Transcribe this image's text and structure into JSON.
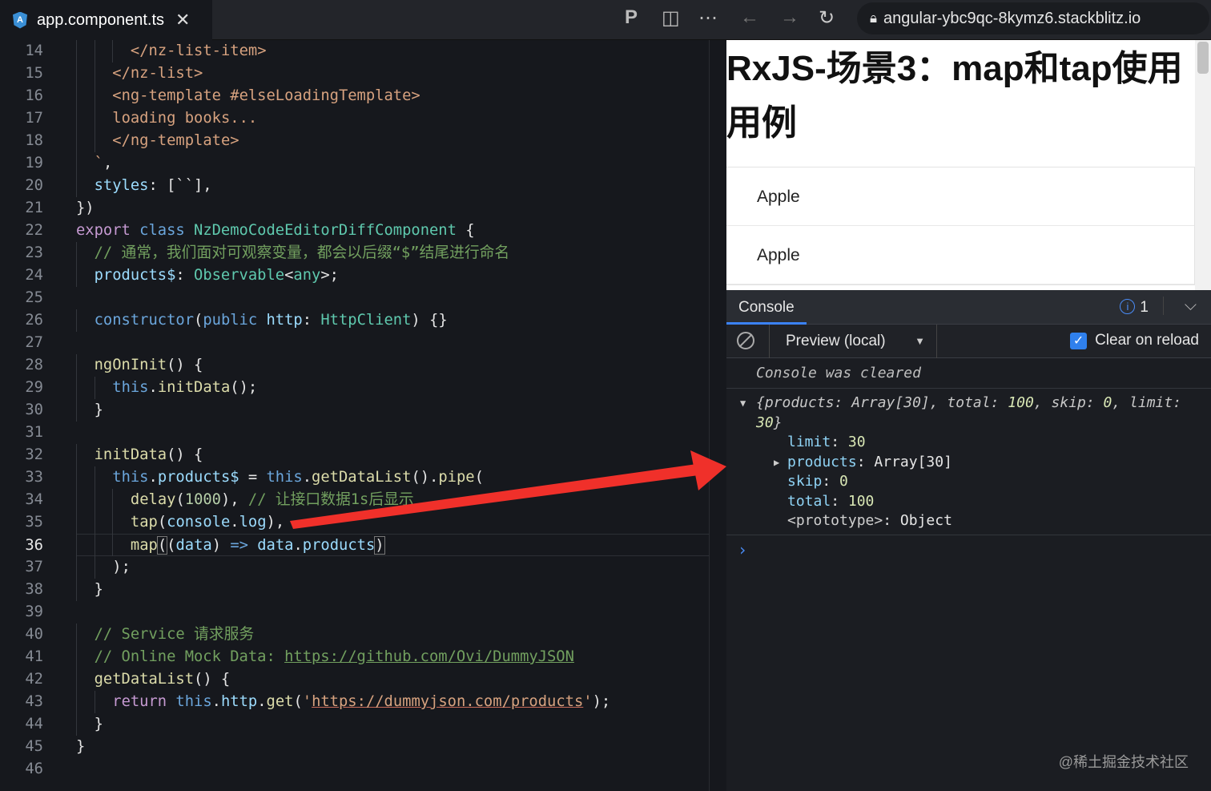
{
  "tab": {
    "icon": "angular-icon",
    "filename": "app.component.ts"
  },
  "address_bar": {
    "url": "angular-ybc9qc-8kymz6.stackblitz.io"
  },
  "editor": {
    "current_line": 36,
    "lines": [
      {
        "n": 14,
        "indent": 6,
        "tokens": [
          [
            "tag",
            "</nz-list-item>"
          ]
        ]
      },
      {
        "n": 15,
        "indent": 4,
        "tokens": [
          [
            "tag",
            "</nz-list>"
          ]
        ]
      },
      {
        "n": 16,
        "indent": 4,
        "tokens": [
          [
            "tag",
            "<ng-template #elseLoadingTemplate>"
          ]
        ]
      },
      {
        "n": 17,
        "indent": 4,
        "tokens": [
          [
            "tag",
            "loading books..."
          ]
        ]
      },
      {
        "n": 18,
        "indent": 4,
        "tokens": [
          [
            "tag",
            "</ng-template>"
          ]
        ]
      },
      {
        "n": 19,
        "indent": 2,
        "tokens": [
          [
            "str",
            "`"
          ],
          [
            "plain",
            ","
          ]
        ]
      },
      {
        "n": 20,
        "indent": 2,
        "tokens": [
          [
            "var",
            "styles"
          ],
          [
            "plain",
            ": [``],"
          ]
        ]
      },
      {
        "n": 21,
        "indent": 0,
        "tokens": [
          [
            "plain",
            "})"
          ]
        ]
      },
      {
        "n": 22,
        "indent": 0,
        "tokens": [
          [
            "kw",
            "export"
          ],
          [
            "plain",
            " "
          ],
          [
            "blue",
            "class"
          ],
          [
            "plain",
            " "
          ],
          [
            "type",
            "NzDemoCodeEditorDiffComponent"
          ],
          [
            "plain",
            " {"
          ]
        ]
      },
      {
        "n": 23,
        "indent": 2,
        "tokens": [
          [
            "com",
            "// 通常，我们面对可观察变量，都会以后缀“$”结尾进行命名"
          ]
        ]
      },
      {
        "n": 24,
        "indent": 2,
        "tokens": [
          [
            "var",
            "products$"
          ],
          [
            "plain",
            ": "
          ],
          [
            "type",
            "Observable"
          ],
          [
            "plain",
            "<"
          ],
          [
            "type",
            "any"
          ],
          [
            "plain",
            ">;"
          ]
        ]
      },
      {
        "n": 25,
        "indent": 0,
        "tokens": []
      },
      {
        "n": 26,
        "indent": 2,
        "tokens": [
          [
            "blue",
            "constructor"
          ],
          [
            "plain",
            "("
          ],
          [
            "blue",
            "public"
          ],
          [
            "plain",
            " "
          ],
          [
            "var",
            "http"
          ],
          [
            "plain",
            ": "
          ],
          [
            "type",
            "HttpClient"
          ],
          [
            "plain",
            ") {}"
          ]
        ]
      },
      {
        "n": 27,
        "indent": 0,
        "tokens": []
      },
      {
        "n": 28,
        "indent": 2,
        "tokens": [
          [
            "fn",
            "ngOnInit"
          ],
          [
            "plain",
            "() {"
          ]
        ]
      },
      {
        "n": 29,
        "indent": 4,
        "tokens": [
          [
            "blue",
            "this"
          ],
          [
            "plain",
            "."
          ],
          [
            "fn",
            "initData"
          ],
          [
            "plain",
            "();"
          ]
        ]
      },
      {
        "n": 30,
        "indent": 2,
        "tokens": [
          [
            "plain",
            "}"
          ]
        ]
      },
      {
        "n": 31,
        "indent": 0,
        "tokens": []
      },
      {
        "n": 32,
        "indent": 2,
        "tokens": [
          [
            "fn",
            "initData"
          ],
          [
            "plain",
            "() {"
          ]
        ]
      },
      {
        "n": 33,
        "indent": 4,
        "tokens": [
          [
            "blue",
            "this"
          ],
          [
            "plain",
            "."
          ],
          [
            "var",
            "products$"
          ],
          [
            "plain",
            " = "
          ],
          [
            "blue",
            "this"
          ],
          [
            "plain",
            "."
          ],
          [
            "fn",
            "getDataList"
          ],
          [
            "plain",
            "()."
          ],
          [
            "fn",
            "pipe"
          ],
          [
            "plain",
            "("
          ]
        ]
      },
      {
        "n": 34,
        "indent": 6,
        "tokens": [
          [
            "fn",
            "delay"
          ],
          [
            "plain",
            "("
          ],
          [
            "num",
            "1000"
          ],
          [
            "plain",
            "), "
          ],
          [
            "com",
            "// 让接口数据1s后显示"
          ]
        ]
      },
      {
        "n": 35,
        "indent": 6,
        "tokens": [
          [
            "fn",
            "tap"
          ],
          [
            "plain",
            "("
          ],
          [
            "var",
            "console"
          ],
          [
            "plain",
            "."
          ],
          [
            "var",
            "log"
          ],
          [
            "plain",
            "),"
          ]
        ]
      },
      {
        "n": 36,
        "indent": 6,
        "tokens": [
          [
            "fn",
            "map"
          ],
          [
            "bk",
            "("
          ],
          [
            "plain",
            "("
          ],
          [
            "var",
            "data"
          ],
          [
            "plain",
            ") "
          ],
          [
            "blue",
            "=>"
          ],
          [
            "plain",
            " "
          ],
          [
            "var",
            "data"
          ],
          [
            "plain",
            "."
          ],
          [
            "var",
            "products"
          ],
          [
            "bk",
            ")"
          ]
        ]
      },
      {
        "n": 37,
        "indent": 4,
        "tokens": [
          [
            "plain",
            ");"
          ]
        ]
      },
      {
        "n": 38,
        "indent": 2,
        "tokens": [
          [
            "plain",
            "}"
          ]
        ]
      },
      {
        "n": 39,
        "indent": 0,
        "tokens": []
      },
      {
        "n": 40,
        "indent": 2,
        "tokens": [
          [
            "com",
            "// Service 请求服务"
          ]
        ]
      },
      {
        "n": 41,
        "indent": 2,
        "tokens": [
          [
            "com",
            "// Online Mock Data: "
          ],
          [
            "link",
            "https://github.com/Ovi/DummyJSON"
          ]
        ]
      },
      {
        "n": 42,
        "indent": 2,
        "tokens": [
          [
            "fn",
            "getDataList"
          ],
          [
            "plain",
            "() {"
          ]
        ]
      },
      {
        "n": 43,
        "indent": 4,
        "tokens": [
          [
            "kw",
            "return"
          ],
          [
            "plain",
            " "
          ],
          [
            "blue",
            "this"
          ],
          [
            "plain",
            "."
          ],
          [
            "var",
            "http"
          ],
          [
            "plain",
            "."
          ],
          [
            "fn",
            "get"
          ],
          [
            "plain",
            "("
          ],
          [
            "str",
            "'"
          ],
          [
            "slink",
            "https://dummyjson.com/products"
          ],
          [
            "str",
            "'"
          ],
          [
            "plain",
            ");"
          ]
        ]
      },
      {
        "n": 44,
        "indent": 2,
        "tokens": [
          [
            "plain",
            "}"
          ]
        ]
      },
      {
        "n": 45,
        "indent": 0,
        "tokens": [
          [
            "plain",
            "}"
          ]
        ]
      },
      {
        "n": 46,
        "indent": 0,
        "tokens": []
      }
    ]
  },
  "preview": {
    "title": "RxJS-场景3：map和tap使用用例",
    "items": [
      "Apple",
      "Apple"
    ]
  },
  "console": {
    "tab_label": "Console",
    "info_count": "1",
    "context_select": "Preview (local)",
    "clear_on_reload_label": "Clear on reload",
    "clear_on_reload": true,
    "cleared_message": "Console was cleared",
    "object_summary": {
      "p1": "{products: Array[30], total: ",
      "total": "100",
      "p2": ", skip: ",
      "skip": "0",
      "p3": ", limit: ",
      "limit": "30",
      "p4": "}"
    },
    "properties": [
      {
        "key": "limit",
        "value": "30",
        "kind": "num"
      },
      {
        "key": "products",
        "value": "Array[30]",
        "kind": "obj",
        "expandable": true
      },
      {
        "key": "skip",
        "value": "0",
        "kind": "num"
      },
      {
        "key": "total",
        "value": "100",
        "kind": "num"
      },
      {
        "key": "<prototype>",
        "value": "Object",
        "kind": "proto"
      }
    ]
  },
  "watermark": "@稀土掘金技术社区",
  "colors": {
    "annotation_arrow": "#f0302a",
    "accent": "#3b82f6"
  }
}
